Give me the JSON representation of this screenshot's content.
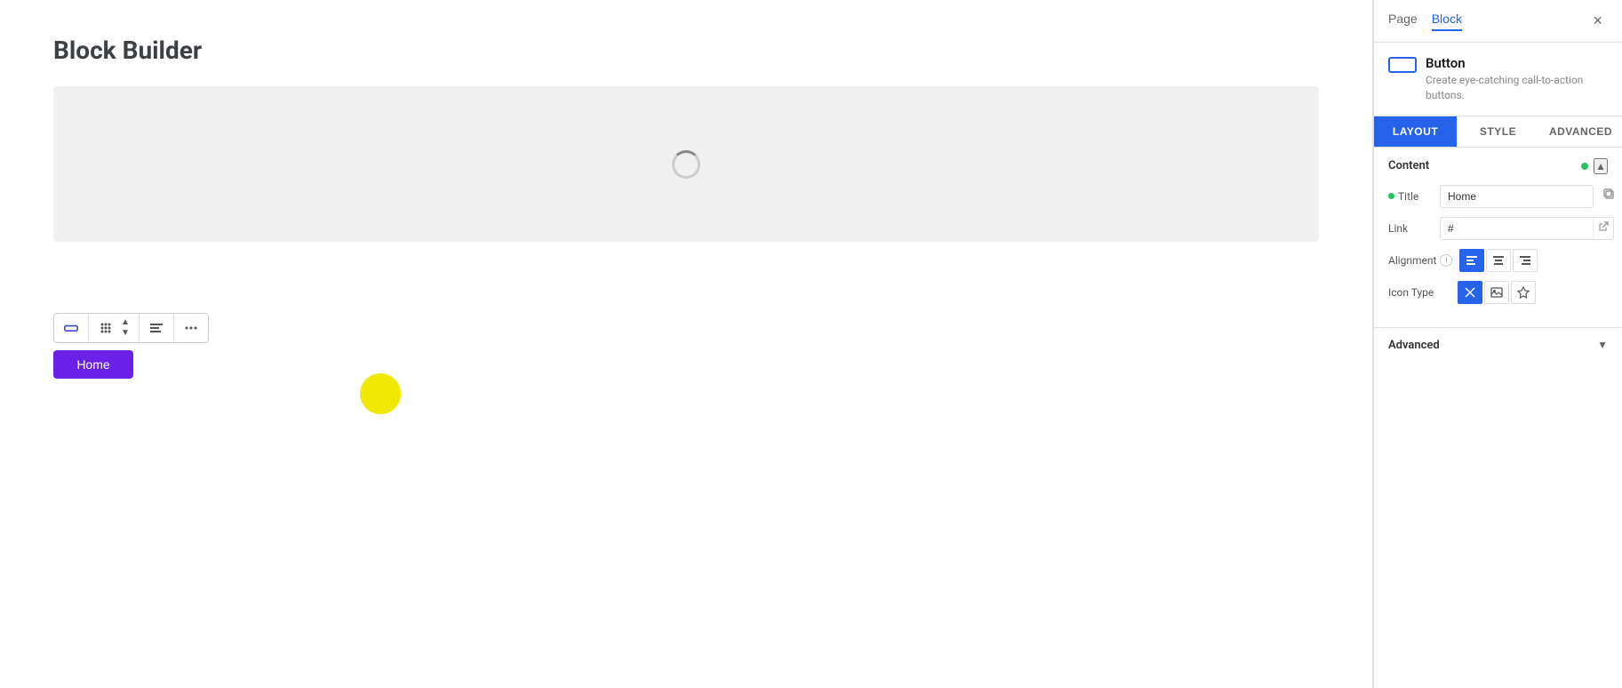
{
  "main": {
    "page_title": "Block Builder",
    "canvas": {
      "loading": true
    },
    "home_button_label": "Home",
    "toolbar": {
      "items": [
        "block-icon",
        "grid-icon",
        "up-arrow",
        "down-arrow",
        "align-icon",
        "more-icon"
      ]
    }
  },
  "right_panel": {
    "tabs": [
      {
        "id": "page",
        "label": "Page"
      },
      {
        "id": "block",
        "label": "Block"
      }
    ],
    "active_tab": "block",
    "close_label": "×",
    "block_info": {
      "name": "Button",
      "description": "Create eye-catching call-to-action buttons."
    },
    "settings_tabs": [
      {
        "id": "layout",
        "label": "LAYOUT"
      },
      {
        "id": "style",
        "label": "STYLE"
      },
      {
        "id": "advanced",
        "label": "ADVANCED"
      }
    ],
    "active_settings_tab": "layout",
    "content_section": {
      "title": "Content",
      "title_field": {
        "label": "Title",
        "value": "Home",
        "has_green_dot": true
      },
      "link_field": {
        "label": "Link",
        "value": "#"
      },
      "alignment": {
        "label": "Alignment",
        "options": [
          "left",
          "center",
          "right"
        ],
        "active": "left"
      },
      "icon_type": {
        "label": "Icon Type",
        "options": [
          "none",
          "image",
          "icon"
        ],
        "active": "none"
      }
    },
    "advanced_section": {
      "title": "Advanced",
      "collapsed": true
    }
  }
}
